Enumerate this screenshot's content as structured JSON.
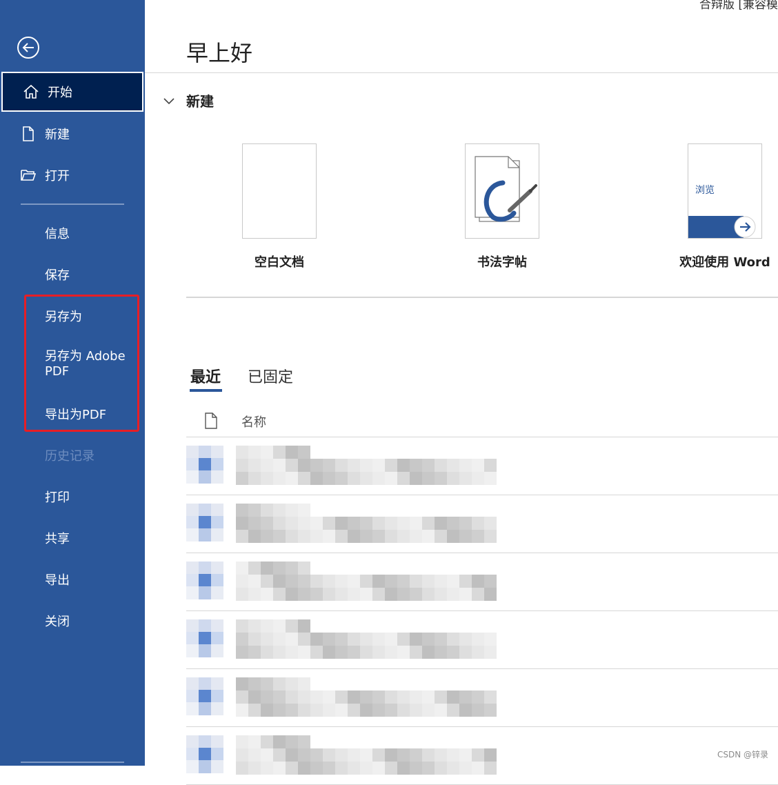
{
  "window": {
    "title_fragment": "合辩版 [兼容模"
  },
  "sidebar": {
    "items": [
      {
        "label": "开始",
        "icon": "home-icon",
        "active": true
      },
      {
        "label": "新建",
        "icon": "new-document-icon"
      },
      {
        "label": "打开",
        "icon": "open-folder-icon"
      },
      {
        "label": "信息"
      },
      {
        "label": "保存"
      },
      {
        "label": "另存为"
      },
      {
        "label": "另存为 Adobe PDF"
      },
      {
        "label": "导出为PDF"
      },
      {
        "label": "历史记录",
        "disabled": true
      },
      {
        "label": "打印"
      },
      {
        "label": "共享"
      },
      {
        "label": "导出"
      },
      {
        "label": "关闭"
      }
    ],
    "highlight_color": "#e81e25",
    "background": "#2b579a"
  },
  "main": {
    "greeting": "早上好",
    "new_section": {
      "title": "新建",
      "templates": [
        {
          "label": "空白文档"
        },
        {
          "label": "书法字帖"
        },
        {
          "label": "欢迎使用 Word",
          "thumb_text": "浏览"
        }
      ]
    },
    "tabs": [
      {
        "label": "最近",
        "active": true
      },
      {
        "label": "已固定"
      }
    ],
    "file_list": {
      "column_name": "名称",
      "rows": [
        {},
        {},
        {},
        {},
        {},
        {}
      ]
    }
  },
  "watermark": "CSDN @锌录"
}
